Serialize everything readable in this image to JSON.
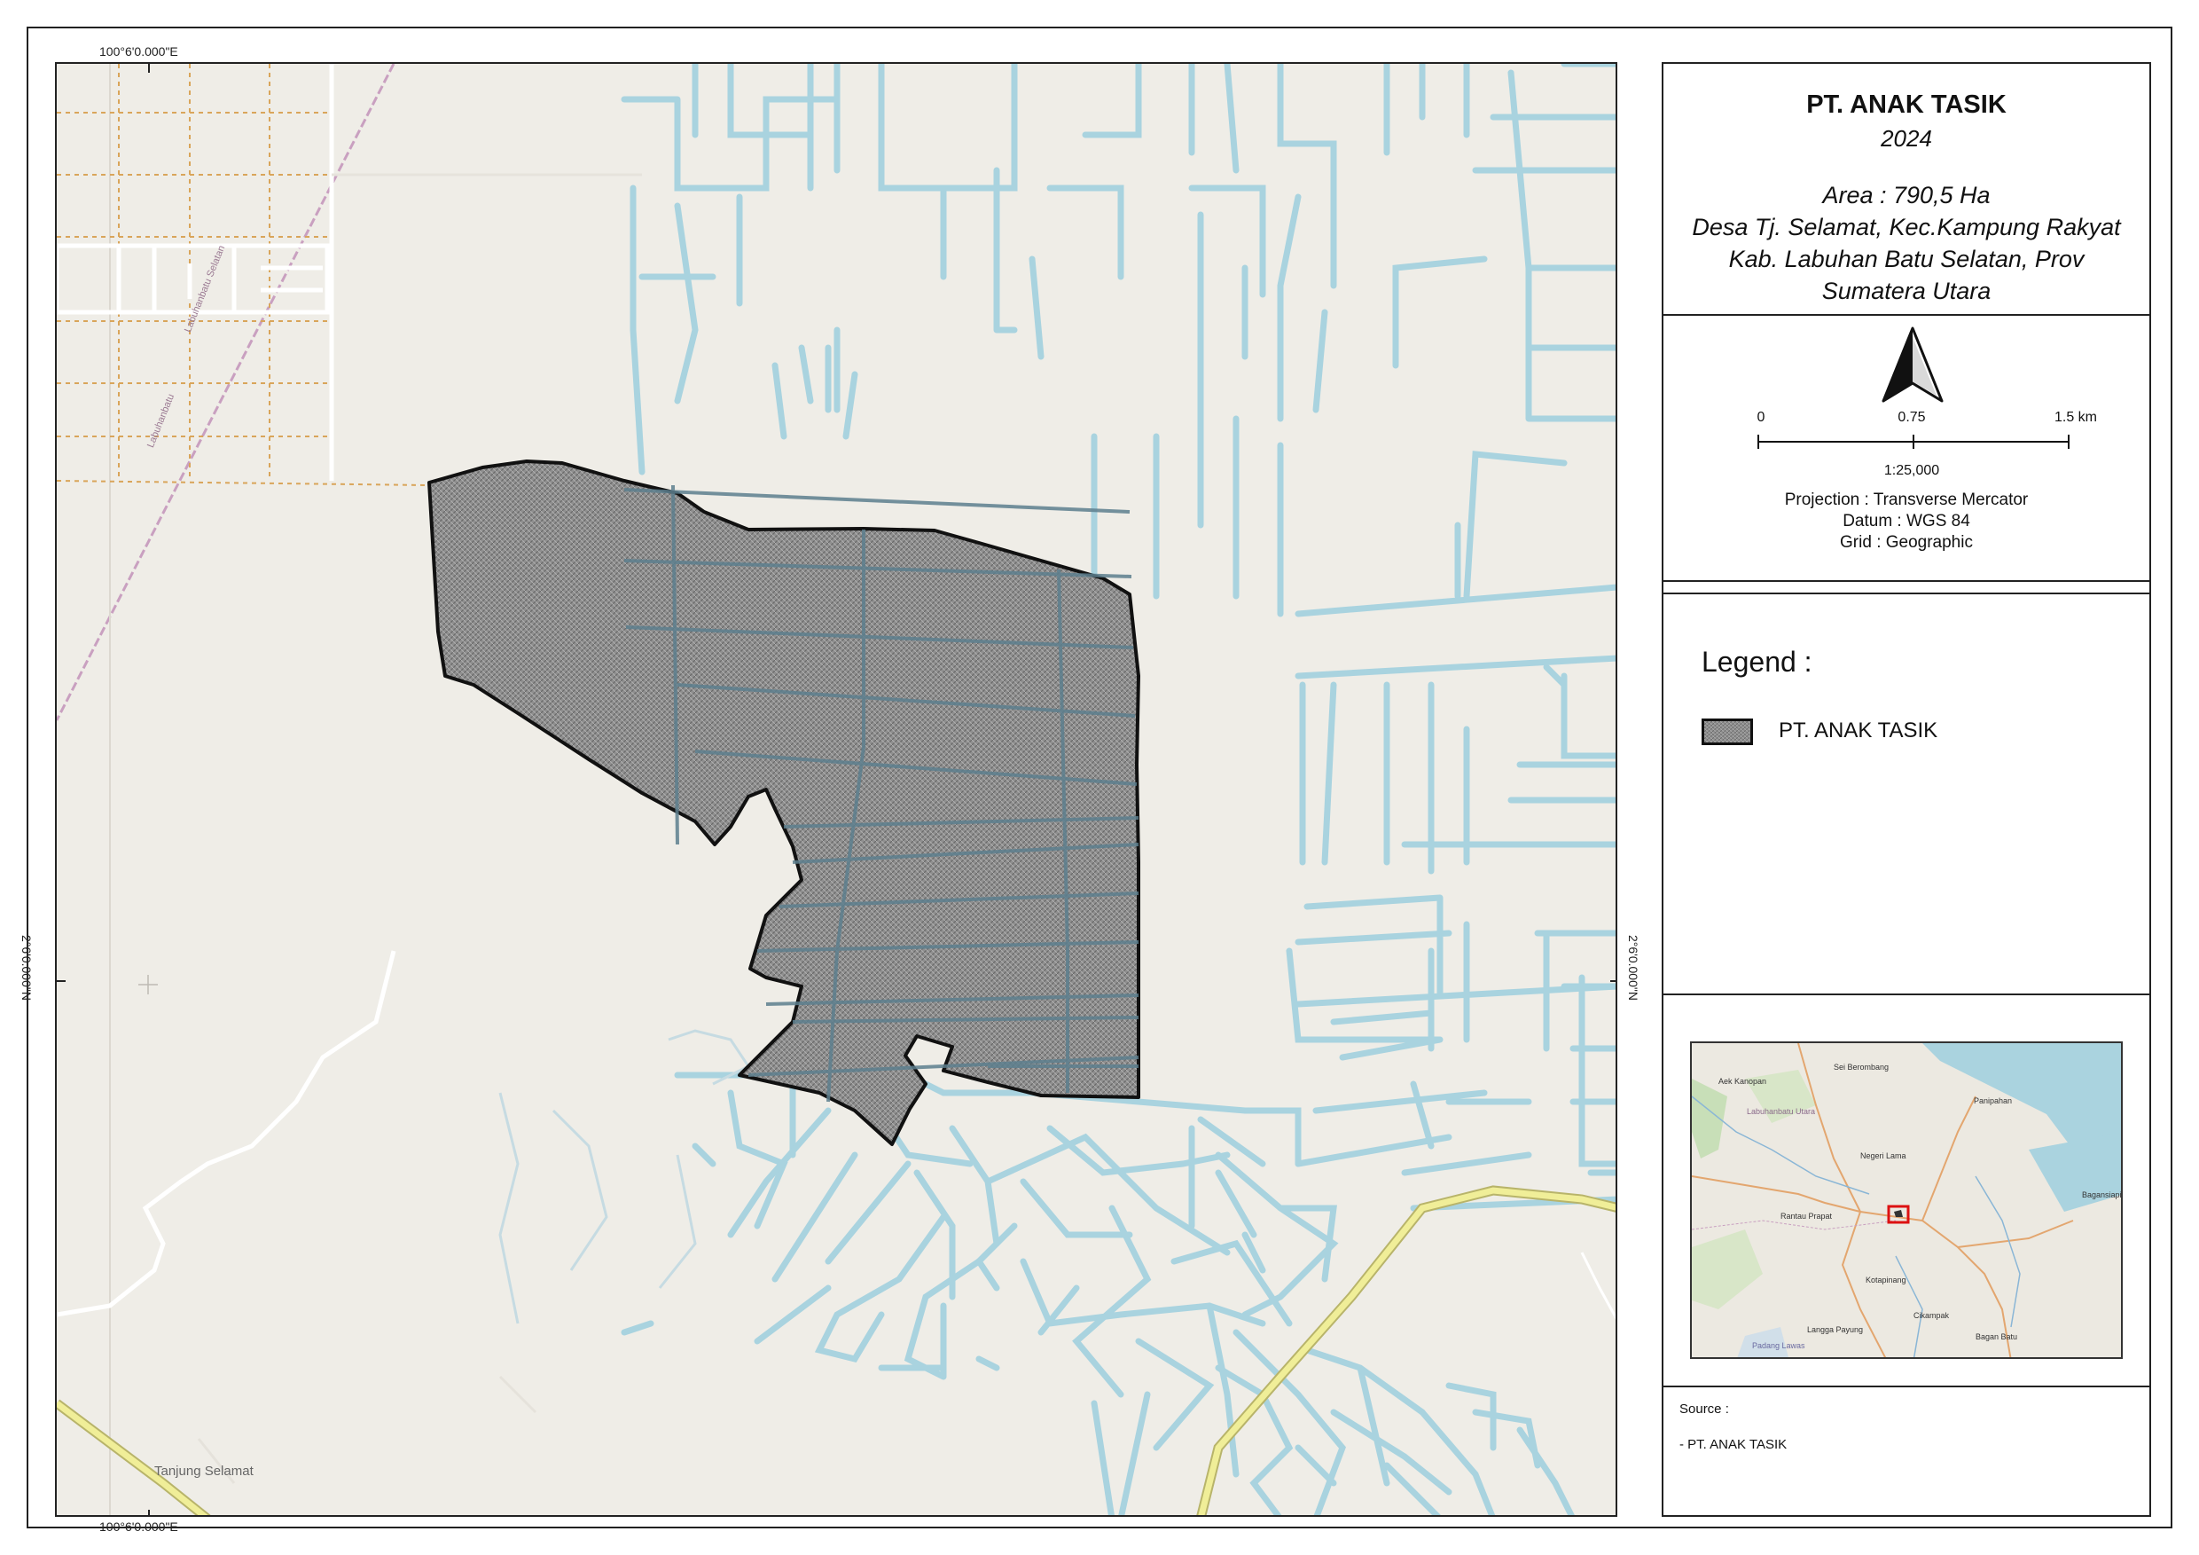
{
  "map": {
    "coords": {
      "lon_top": "100°6'0.000\"E",
      "lon_bottom": "100°6'0.000\"E",
      "lat_left": "2°6'0.000\"N",
      "lat_right": "2°6'0.000\"N"
    },
    "place_labels": {
      "village": "Tanjung Selamat",
      "road_1": "Labuhanbatu Selatan",
      "road_2": "Labuhanbatu"
    },
    "colors": {
      "background": "#efede7",
      "water": "#a9d3df",
      "area_fill": "#8f8f8f",
      "outline": "#111111",
      "road_yellow": "#f0ee98",
      "road_white": "#ffffff",
      "rail": "#c9a0c0"
    }
  },
  "panel": {
    "title": "PT. ANAK TASIK",
    "year": "2024",
    "info_lines": [
      "Area : 790,5 Ha",
      "Desa Tj. Selamat, Kec.Kampung Rakyat",
      "Kab. Labuhan Batu Selatan, Prov",
      "Sumatera Utara"
    ],
    "north_arrow": "north-arrow-icon",
    "scalebar": {
      "label_0": "0",
      "label_mid": "0.75",
      "label_end": "1.5 km",
      "ratio": "1:25,000"
    },
    "projection": [
      "Projection : Transverse Mercator",
      "Datum : WGS 84",
      "Grid : Geographic"
    ],
    "legend": {
      "title": "Legend :",
      "items": [
        {
          "label": "PT. ANAK TASIK"
        }
      ]
    },
    "inset": {
      "labels": [
        "Aek Kanopan",
        "Sei Berombang",
        "Panipahan",
        "Negeri Lama",
        "Rantau Prapat",
        "Bagansiapiapi",
        "Kotapinang",
        "Cikampak",
        "Langga Payung",
        "Bagan Batu",
        "Labuhanbatu Utara",
        "Padang Lawas"
      ]
    },
    "source": {
      "title": "Source :",
      "item": "- PT. ANAK TASIK"
    }
  }
}
